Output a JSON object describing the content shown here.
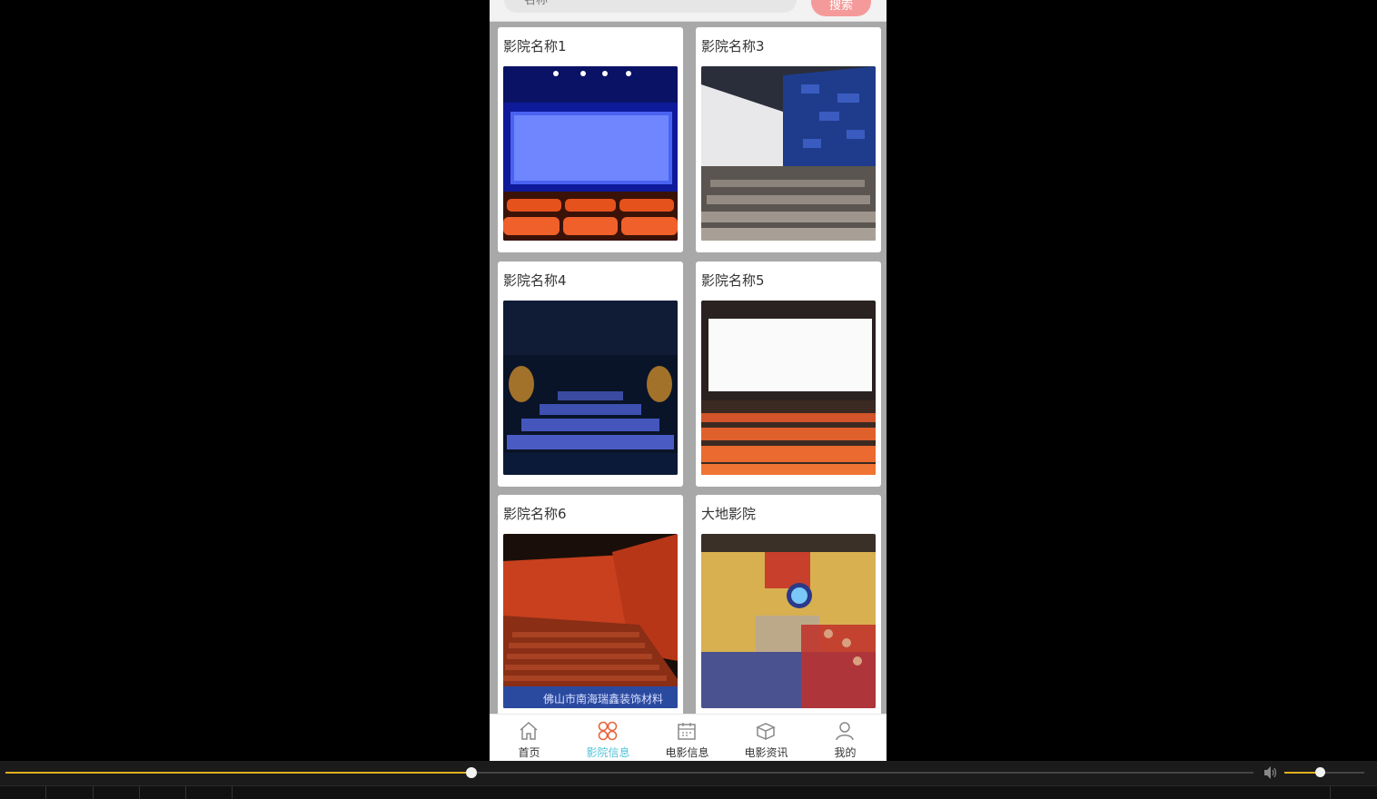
{
  "search": {
    "placeholder": "名称",
    "button_label": "搜索"
  },
  "cinemas": [
    {
      "name": "影院名称1",
      "photo": "blue-lit screen with red seats"
    },
    {
      "name": "影院名称3",
      "photo": "hall with blue wall panels and grey seats"
    },
    {
      "name": "影院名称4",
      "photo": "dark hall with blue seats"
    },
    {
      "name": "影院名称5",
      "photo": "white screen with orange seats"
    },
    {
      "name": "影院名称6",
      "photo": "red hall with tiered seating"
    },
    {
      "name": "大地影院",
      "photo": "yellow-walled hall with audience"
    }
  ],
  "photo_watermark": "佛山市南海瑞鑫装饰材料",
  "tabs": [
    {
      "label": "首页",
      "icon": "home-icon",
      "active": false
    },
    {
      "label": "影院信息",
      "icon": "clover-icon",
      "active": true
    },
    {
      "label": "电影信息",
      "icon": "calendar-icon",
      "active": false
    },
    {
      "label": "电影资讯",
      "icon": "box-icon",
      "active": false
    },
    {
      "label": "我的",
      "icon": "person-icon",
      "active": false
    }
  ],
  "colors": {
    "active_tab": "#4fc3d9",
    "search_button": "#f59a9a",
    "seek_bar": "#e0b020"
  },
  "player": {
    "progress": 0.373,
    "volume": 0.44
  }
}
